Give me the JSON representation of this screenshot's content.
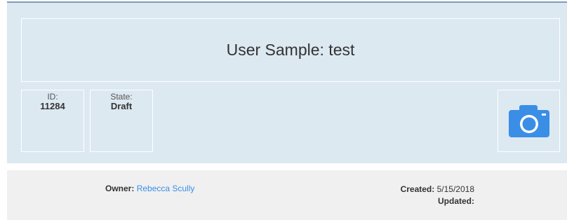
{
  "header": {
    "title": "User Sample: test",
    "id_label": "ID:",
    "id_value": "11284",
    "state_label": "State:",
    "state_value": "Draft",
    "photo_icon": "camera-icon",
    "accent_color": "#3a8ee6"
  },
  "footer": {
    "owner_label": "Owner:",
    "owner_name": "Rebecca Scully",
    "created_label": "Created:",
    "created_value": "5/15/2018",
    "updated_label": "Updated:",
    "updated_value": ""
  }
}
